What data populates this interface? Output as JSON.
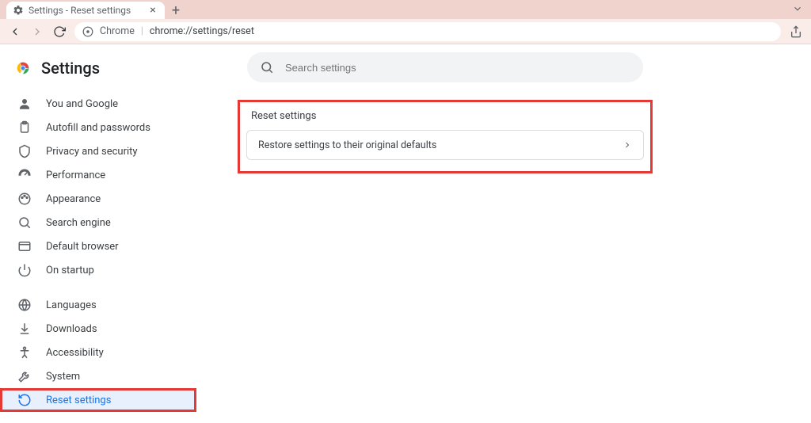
{
  "tab": {
    "title": "Settings - Reset settings"
  },
  "address": {
    "zone": "Chrome",
    "url": "chrome://settings/reset"
  },
  "app_title": "Settings",
  "search": {
    "placeholder": "Search settings"
  },
  "sidebar": {
    "group1": [
      {
        "label": "You and Google"
      },
      {
        "label": "Autofill and passwords"
      },
      {
        "label": "Privacy and security"
      },
      {
        "label": "Performance"
      },
      {
        "label": "Appearance"
      },
      {
        "label": "Search engine"
      },
      {
        "label": "Default browser"
      },
      {
        "label": "On startup"
      }
    ],
    "group2": [
      {
        "label": "Languages"
      },
      {
        "label": "Downloads"
      },
      {
        "label": "Accessibility"
      },
      {
        "label": "System"
      },
      {
        "label": "Reset settings"
      }
    ]
  },
  "panel": {
    "title": "Reset settings",
    "row": "Restore settings to their original defaults"
  }
}
